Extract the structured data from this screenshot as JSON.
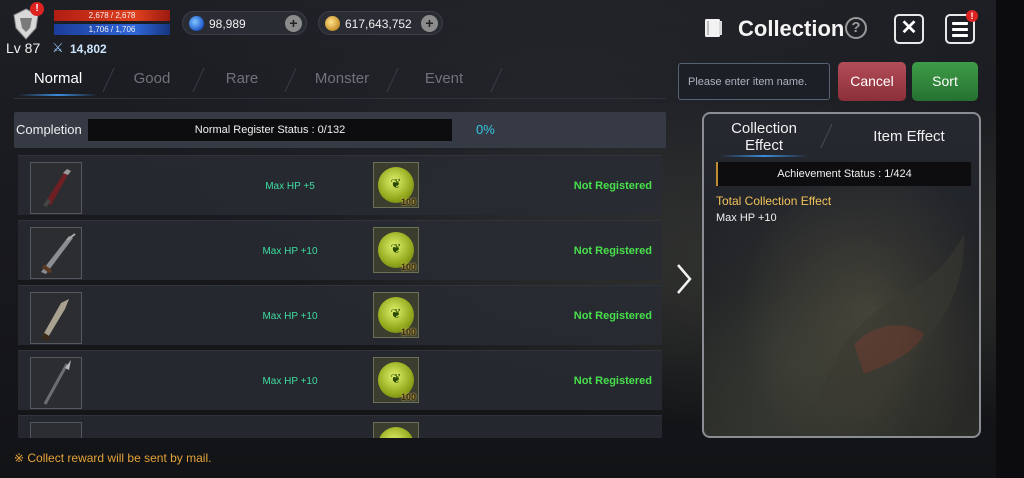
{
  "hud": {
    "hp_text": "2,678 / 2,678",
    "mp_text": "1,706 / 1,706",
    "level": "Lv 87",
    "combat_power": "14,802",
    "avatar_badge": "!",
    "gems": "98,989",
    "gold": "617,643,752"
  },
  "header": {
    "title": "Collection",
    "menu_badge": "!"
  },
  "tabs": [
    {
      "label": "Normal",
      "active": true
    },
    {
      "label": "Good"
    },
    {
      "label": "Rare"
    },
    {
      "label": "Monster"
    },
    {
      "label": "Event"
    }
  ],
  "search": {
    "placeholder": "Please enter item name."
  },
  "buttons": {
    "cancel": "Cancel",
    "sort": "Sort"
  },
  "completion": {
    "label": "Completion",
    "status": "Normal Register Status : 0/132",
    "percent": "0%"
  },
  "items": [
    {
      "icon": "dagger-icon",
      "effect": "Max HP +5",
      "material_qty": "100",
      "status": "Not Registered"
    },
    {
      "icon": "sword-icon",
      "effect": "Max HP +10",
      "material_qty": "100",
      "status": "Not Registered"
    },
    {
      "icon": "blade-icon",
      "effect": "Max HP +10",
      "material_qty": "100",
      "status": "Not Registered"
    },
    {
      "icon": "spear-icon",
      "effect": "Max HP +10",
      "material_qty": "100",
      "status": "Not Registered"
    }
  ],
  "panel": {
    "tab_collection": "Collection Effect",
    "tab_item": "Item Effect",
    "achievement": "Achievement Status : 1/424",
    "total_title": "Total Collection Effect",
    "total_value": "Max HP +10"
  },
  "footer_note": "※ Collect reward will be sent by mail.",
  "colors": {
    "accent_blue": "#3c8cdc",
    "registered_green": "#48e04c",
    "effect_teal": "#3fdca0",
    "cancel_red": "#b34d58",
    "sort_green": "#3e9c47",
    "note_orange": "#e3a23a"
  }
}
